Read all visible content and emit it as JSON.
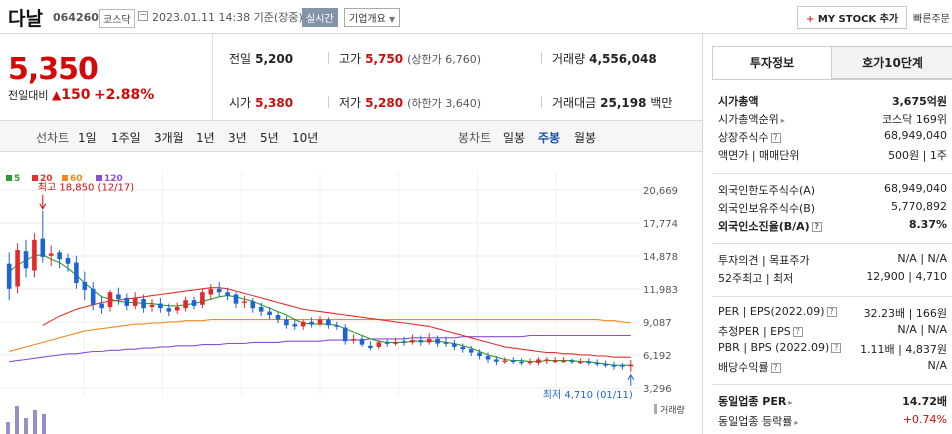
{
  "header": {
    "name": "다날",
    "code": "064260",
    "market": "코스닥",
    "datetime": "2023.01.11 14:38 기준(장중)",
    "realtime": "실시간",
    "company_info": "기업개요",
    "mystock": "MY STOCK 추가",
    "quick_order": "빠른주문"
  },
  "price": {
    "current": "5,350",
    "change_label": "전일대비",
    "change": "150",
    "change_pct": "+2.88%"
  },
  "quote": {
    "prev_label": "전일",
    "prev": "5,200",
    "high_label": "고가",
    "high": "5,750",
    "upper_limit": "(상한가 6,760)",
    "volume_label": "거래량",
    "volume": "4,556,048",
    "open_label": "시가",
    "open": "5,380",
    "low_label": "저가",
    "low": "5,280",
    "lower_limit": "(하한가 3,640)",
    "amount_label": "거래대금",
    "amount": "25,198",
    "amount_unit": "백만"
  },
  "toolbar": {
    "line_label": "선차트",
    "periods": [
      "1일",
      "1주일",
      "3개월",
      "1년",
      "3년",
      "5년",
      "10년"
    ],
    "candle_label": "봉차트",
    "candle_periods": [
      "일봉",
      "주봉",
      "월봉"
    ],
    "active_candle": "주봉"
  },
  "chart_data": {
    "type": "candlestick",
    "ma_legend": [
      {
        "name": "5",
        "color": "#2c9c2c"
      },
      {
        "name": "20",
        "color": "#e03030"
      },
      {
        "name": "60",
        "color": "#f08a1e"
      },
      {
        "name": "120",
        "color": "#8a4fd6"
      }
    ],
    "y_ticks": [
      "20,669",
      "17,774",
      "14,878",
      "11,983",
      "9,087",
      "6,192",
      "3,296"
    ],
    "ylim": [
      3296,
      20669
    ],
    "annotations": {
      "high": "최고 18,850 (12/17)",
      "low": "최저 4,710 (01/11)"
    },
    "volume_label": "거래량",
    "candles": [
      {
        "o": 14200,
        "c": 12000,
        "h": 15200,
        "l": 11000
      },
      {
        "o": 12200,
        "c": 15400,
        "h": 16000,
        "l": 11600
      },
      {
        "o": 15300,
        "c": 13800,
        "h": 16300,
        "l": 13000
      },
      {
        "o": 13600,
        "c": 16300,
        "h": 16900,
        "l": 13000
      },
      {
        "o": 16400,
        "c": 14800,
        "h": 18850,
        "l": 14300
      },
      {
        "o": 14900,
        "c": 15100,
        "h": 15800,
        "l": 14000
      },
      {
        "o": 15200,
        "c": 14600,
        "h": 15400,
        "l": 13800
      },
      {
        "o": 14700,
        "c": 14200,
        "h": 15100,
        "l": 13500
      },
      {
        "o": 14300,
        "c": 12500,
        "h": 14900,
        "l": 12000
      },
      {
        "o": 12600,
        "c": 11900,
        "h": 13500,
        "l": 11000
      },
      {
        "o": 12000,
        "c": 10600,
        "h": 12600,
        "l": 10100
      },
      {
        "o": 10700,
        "c": 10300,
        "h": 11400,
        "l": 9800
      },
      {
        "o": 10400,
        "c": 11700,
        "h": 11900,
        "l": 10000
      },
      {
        "o": 11500,
        "c": 11100,
        "h": 12100,
        "l": 10600
      },
      {
        "o": 11200,
        "c": 10500,
        "h": 11600,
        "l": 10100
      },
      {
        "o": 10500,
        "c": 11200,
        "h": 11700,
        "l": 10200
      },
      {
        "o": 11100,
        "c": 10300,
        "h": 11500,
        "l": 9900
      },
      {
        "o": 10400,
        "c": 10600,
        "h": 11100,
        "l": 10000
      },
      {
        "o": 10700,
        "c": 10300,
        "h": 11200,
        "l": 9900
      },
      {
        "o": 10300,
        "c": 10000,
        "h": 10700,
        "l": 9600
      },
      {
        "o": 10100,
        "c": 10400,
        "h": 10800,
        "l": 9800
      },
      {
        "o": 10300,
        "c": 11000,
        "h": 11300,
        "l": 10000
      },
      {
        "o": 11000,
        "c": 10500,
        "h": 11300,
        "l": 10200
      },
      {
        "o": 10600,
        "c": 11700,
        "h": 12000,
        "l": 10300
      },
      {
        "o": 11500,
        "c": 12000,
        "h": 12400,
        "l": 11000
      },
      {
        "o": 12000,
        "c": 11700,
        "h": 12600,
        "l": 11300
      },
      {
        "o": 11700,
        "c": 11400,
        "h": 12100,
        "l": 11000
      },
      {
        "o": 11500,
        "c": 10700,
        "h": 11700,
        "l": 10300
      },
      {
        "o": 10800,
        "c": 10900,
        "h": 11400,
        "l": 10300
      },
      {
        "o": 10900,
        "c": 10300,
        "h": 11200,
        "l": 9900
      },
      {
        "o": 10400,
        "c": 10000,
        "h": 10800,
        "l": 9600
      },
      {
        "o": 10000,
        "c": 9700,
        "h": 10400,
        "l": 9300
      },
      {
        "o": 9700,
        "c": 9300,
        "h": 10000,
        "l": 9000
      },
      {
        "o": 9300,
        "c": 8800,
        "h": 9600,
        "l": 8500
      },
      {
        "o": 8900,
        "c": 8700,
        "h": 9300,
        "l": 8400
      },
      {
        "o": 8700,
        "c": 9100,
        "h": 9300,
        "l": 8400
      },
      {
        "o": 9100,
        "c": 8900,
        "h": 9500,
        "l": 8600
      },
      {
        "o": 8900,
        "c": 9300,
        "h": 9600,
        "l": 8700
      },
      {
        "o": 9300,
        "c": 8800,
        "h": 9500,
        "l": 8500
      },
      {
        "o": 8800,
        "c": 8700,
        "h": 9100,
        "l": 8400
      },
      {
        "o": 8600,
        "c": 7400,
        "h": 8900,
        "l": 7100
      },
      {
        "o": 7500,
        "c": 7600,
        "h": 8000,
        "l": 7200
      },
      {
        "o": 7600,
        "c": 7100,
        "h": 7900,
        "l": 6900
      },
      {
        "o": 7000,
        "c": 6800,
        "h": 7400,
        "l": 6600
      },
      {
        "o": 6900,
        "c": 7300,
        "h": 7500,
        "l": 6700
      },
      {
        "o": 7300,
        "c": 7200,
        "h": 7600,
        "l": 6900
      },
      {
        "o": 7200,
        "c": 7300,
        "h": 7700,
        "l": 7000
      },
      {
        "o": 7400,
        "c": 7300,
        "h": 7800,
        "l": 7000
      },
      {
        "o": 7300,
        "c": 7500,
        "h": 8000,
        "l": 7100
      },
      {
        "o": 7500,
        "c": 7300,
        "h": 7900,
        "l": 7000
      },
      {
        "o": 7300,
        "c": 7600,
        "h": 8100,
        "l": 7100
      },
      {
        "o": 7600,
        "c": 7200,
        "h": 7900,
        "l": 6900
      },
      {
        "o": 7300,
        "c": 7200,
        "h": 7800,
        "l": 6900
      },
      {
        "o": 7200,
        "c": 6900,
        "h": 7500,
        "l": 6600
      },
      {
        "o": 6900,
        "c": 6700,
        "h": 7200,
        "l": 6400
      },
      {
        "o": 6700,
        "c": 6400,
        "h": 7000,
        "l": 6100
      },
      {
        "o": 6400,
        "c": 6100,
        "h": 6700,
        "l": 5800
      },
      {
        "o": 6100,
        "c": 5800,
        "h": 6400,
        "l": 5500
      },
      {
        "o": 5800,
        "c": 5600,
        "h": 6100,
        "l": 5300
      },
      {
        "o": 5600,
        "c": 5700,
        "h": 6000,
        "l": 5400
      },
      {
        "o": 5700,
        "c": 5600,
        "h": 6000,
        "l": 5400
      },
      {
        "o": 5600,
        "c": 5500,
        "h": 5900,
        "l": 5300
      },
      {
        "o": 5500,
        "c": 5600,
        "h": 5900,
        "l": 5300
      },
      {
        "o": 5500,
        "c": 5800,
        "h": 6000,
        "l": 5300
      },
      {
        "o": 5800,
        "c": 5800,
        "h": 6000,
        "l": 5400
      },
      {
        "o": 5700,
        "c": 5700,
        "h": 6000,
        "l": 5500
      },
      {
        "o": 5700,
        "c": 5700,
        "h": 6000,
        "l": 5500
      },
      {
        "o": 5700,
        "c": 5600,
        "h": 5900,
        "l": 5400
      },
      {
        "o": 5600,
        "c": 5600,
        "h": 5900,
        "l": 5400
      },
      {
        "o": 5600,
        "c": 5500,
        "h": 5900,
        "l": 5300
      },
      {
        "o": 5500,
        "c": 5400,
        "h": 5800,
        "l": 5200
      },
      {
        "o": 5400,
        "c": 5300,
        "h": 5700,
        "l": 5100
      },
      {
        "o": 5300,
        "c": 5200,
        "h": 5600,
        "l": 4900
      },
      {
        "o": 5300,
        "c": 5200,
        "h": 5500,
        "l": 4900
      },
      {
        "o": 5200,
        "c": 5350,
        "h": 5750,
        "l": 4710
      }
    ],
    "ma5": [
      13500,
      14100,
      14500,
      14900,
      15000,
      14600,
      14300,
      13800,
      13200,
      12500,
      11900,
      11300,
      11100,
      10900,
      10800,
      10800,
      10700,
      10700,
      10600,
      10500,
      10500,
      10600,
      10700,
      10900,
      11100,
      11300,
      11400,
      11300,
      11100,
      10900,
      10600,
      10300,
      10000,
      9700,
      9300,
      9000,
      8900,
      8900,
      8900,
      8800,
      8500,
      8200,
      7900,
      7600,
      7400,
      7300,
      7300,
      7300,
      7400,
      7400,
      7400,
      7400,
      7300,
      7200,
      7000,
      6800,
      6500,
      6200,
      6000,
      5800,
      5700,
      5700,
      5600,
      5600,
      5700,
      5700,
      5700,
      5700,
      5600,
      5600,
      5500,
      5400,
      5300,
      5300,
      5300
    ],
    "ma20": [
      null,
      null,
      null,
      null,
      8800,
      9200,
      9600,
      9900,
      10200,
      10400,
      10600,
      10800,
      10900,
      11000,
      11100,
      11200,
      11300,
      11400,
      11500,
      11600,
      11700,
      11800,
      11900,
      12000,
      12100,
      12100,
      12000,
      11800,
      11600,
      11400,
      11200,
      11000,
      10800,
      10600,
      10400,
      10200,
      10100,
      10000,
      9900,
      9800,
      9700,
      9600,
      9500,
      9400,
      9300,
      9200,
      9100,
      9000,
      8900,
      8800,
      8700,
      8500,
      8300,
      8100,
      7900,
      7700,
      7500,
      7300,
      7100,
      6900,
      6800,
      6700,
      6600,
      6500,
      6400,
      6400,
      6300,
      6300,
      6200,
      6200,
      6100,
      6100,
      6000,
      6000,
      6000
    ],
    "ma60": [
      6500,
      6700,
      6900,
      7100,
      7300,
      7500,
      7700,
      7900,
      8100,
      8300,
      8400,
      8500,
      8600,
      8700,
      8800,
      8900,
      8900,
      9000,
      9000,
      9100,
      9100,
      9200,
      9200,
      9200,
      9300,
      9300,
      9300,
      9300,
      9300,
      9300,
      9300,
      9300,
      9300,
      9300,
      9300,
      9300,
      9300,
      9300,
      9300,
      9300,
      9300,
      9300,
      9300,
      9300,
      9300,
      9300,
      9300,
      9300,
      9300,
      9300,
      9300,
      9300,
      9300,
      9300,
      9300,
      9300,
      9300,
      9300,
      9300,
      9300,
      9300,
      9300,
      9300,
      9300,
      9300,
      9300,
      9300,
      9300,
      9300,
      9300,
      9300,
      9200,
      9200,
      9100,
      9000
    ],
    "ma120": [
      5600,
      5700,
      5800,
      5900,
      6000,
      6100,
      6200,
      6300,
      6300,
      6400,
      6500,
      6500,
      6600,
      6600,
      6700,
      6700,
      6800,
      6800,
      6900,
      6900,
      7000,
      7000,
      7000,
      7100,
      7100,
      7100,
      7200,
      7200,
      7200,
      7300,
      7300,
      7300,
      7300,
      7400,
      7400,
      7400,
      7400,
      7400,
      7500,
      7500,
      7500,
      7500,
      7500,
      7600,
      7600,
      7600,
      7600,
      7600,
      7700,
      7700,
      7700,
      7700,
      7700,
      7700,
      7800,
      7800,
      7800,
      7800,
      7800,
      7800,
      7800,
      7800,
      7900,
      7900,
      7900,
      7900,
      7900,
      7900,
      7900,
      7900,
      7900,
      7900,
      7900,
      7900,
      7900
    ],
    "volume": [
      3,
      7,
      4,
      6,
      5
    ]
  },
  "panel": {
    "tab_active": "투자정보",
    "tab_other": "호가10단계",
    "rows": [
      {
        "k": "시가총액",
        "v": "3,675억원",
        "bold": true
      },
      {
        "k": "시가총액순위",
        "v": "코스닥 169위"
      },
      {
        "k": "상장주식수",
        "v": "68,949,040"
      },
      {
        "k": "액면가 | 매매단위",
        "v": "500원 | 1주"
      },
      {
        "k": "외국인한도주식수(A)",
        "v": "68,949,040"
      },
      {
        "k": "외국인보유주식수(B)",
        "v": "5,770,892"
      },
      {
        "k": "외국인소진율(B/A)",
        "v": "8.37%",
        "bold": true
      },
      {
        "k": "투자의견 | 목표주가",
        "v": "N/A | N/A"
      },
      {
        "k": "52주최고 | 최저",
        "v": "12,900 | 4,710"
      },
      {
        "k": "PER | EPS(2022.09)",
        "v": "32.23배 | 166원"
      },
      {
        "k": "추정PER | EPS",
        "v": "N/A | N/A"
      },
      {
        "k": "PBR | BPS (2022.09)",
        "v": "1.11배 | 4,837원"
      },
      {
        "k": "배당수익률",
        "v": "N/A"
      },
      {
        "k": "동일업종 PER",
        "v": "14.72배",
        "bold": true
      },
      {
        "k": "동일업종 등락률",
        "v": "+0.74%",
        "red": true
      }
    ]
  }
}
